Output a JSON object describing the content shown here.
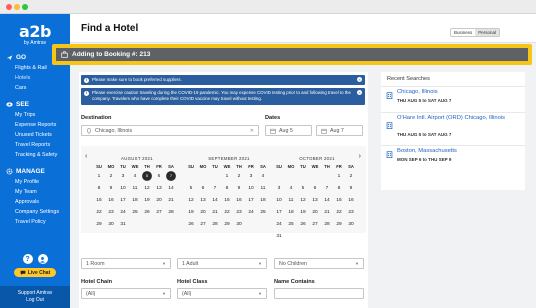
{
  "brand": {
    "logo": "a2b",
    "byline": "by Amtrav"
  },
  "sidebar": {
    "sections": [
      {
        "title": "GO",
        "items": [
          "Flights & Rail",
          "Hotels",
          "Cars"
        ]
      },
      {
        "title": "SEE",
        "items": [
          "My Trips",
          "Expense Reports",
          "Unused Tickets",
          "Travel Reports",
          "Tracking & Safety"
        ]
      },
      {
        "title": "MANAGE",
        "items": [
          "My Profile",
          "My Team",
          "Approvals",
          "Company Settings",
          "Travel Policy"
        ]
      }
    ],
    "live_chat": "Live Chat",
    "support_title": "Support Amtrav",
    "logout": "Log Out"
  },
  "header": {
    "title": "Find a Hotel",
    "toggle": [
      "Business",
      "Personal"
    ]
  },
  "booking_banner": "Adding to Booking #: 213",
  "alerts": [
    "Please make sure to book preferred suppliers.",
    "Please exercise caution traveling during the COVID-19 pandemic. You may expense COVID testing prior to and following travel to the company. Travelers who have complete their COVID vaccine may travel without testing."
  ],
  "search": {
    "destination_label": "Destination",
    "destination_value": "Chicago, Illinois",
    "dates_label": "Dates",
    "checkin": "Aug 5",
    "checkout": "Aug 7",
    "rooms": "1 Room",
    "adults": "1 Adult",
    "children": "No Children",
    "chain_label": "Hotel Chain",
    "chain_value": "(All)",
    "class_label": "Hotel Class",
    "class_value": "(All)",
    "name_label": "Name Contains"
  },
  "calendar": {
    "weekdays": [
      "SU",
      "MO",
      "TU",
      "WE",
      "TH",
      "FR",
      "SA"
    ],
    "months": [
      {
        "title": "AUGUST 2021",
        "offset": 0,
        "days": 31,
        "selected": [
          5,
          7
        ]
      },
      {
        "title": "SEPTEMBER 2021",
        "offset": 3,
        "days": 30,
        "selected": []
      },
      {
        "title": "OCTOBER 2021",
        "offset": 5,
        "days": 31,
        "selected": []
      }
    ]
  },
  "recent": {
    "title": "Recent Searches",
    "items": [
      {
        "city": "Chicago, Illinois",
        "dates": "THU AUG 5 to SAT AUG 7"
      },
      {
        "city": "O'Hare Intl. Airport (ORD) Chicago, Illinois",
        "dates": "THU AUG 5 to SAT AUG 7"
      },
      {
        "city": "Boston, Massachusetts",
        "dates": "MON SEP 6 to THU SEP 9"
      }
    ]
  }
}
